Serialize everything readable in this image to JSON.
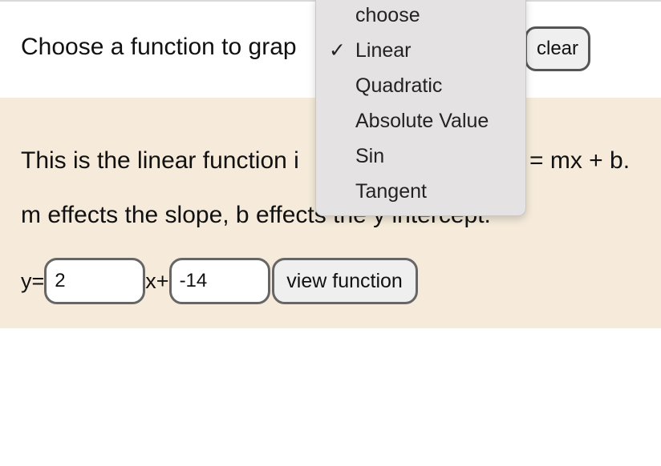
{
  "header": {
    "prompt": "Choose a function to grap",
    "clear_label": "clear"
  },
  "dropdown": {
    "options": [
      "choose",
      "Linear",
      "Quadratic",
      "Absolute Value",
      "Sin",
      "Tangent"
    ],
    "selected": "Linear",
    "check_glyph": "✓"
  },
  "panel": {
    "description_start": "This is the linear function i",
    "description_end": "= mx + b.",
    "effects_text": "m effects the slope, b effects the y intercept.",
    "y_label": "y=",
    "x_label": "x+",
    "m_value": "2",
    "b_value": "-14",
    "view_label": "view function",
    "background": "#f6ebdb"
  }
}
